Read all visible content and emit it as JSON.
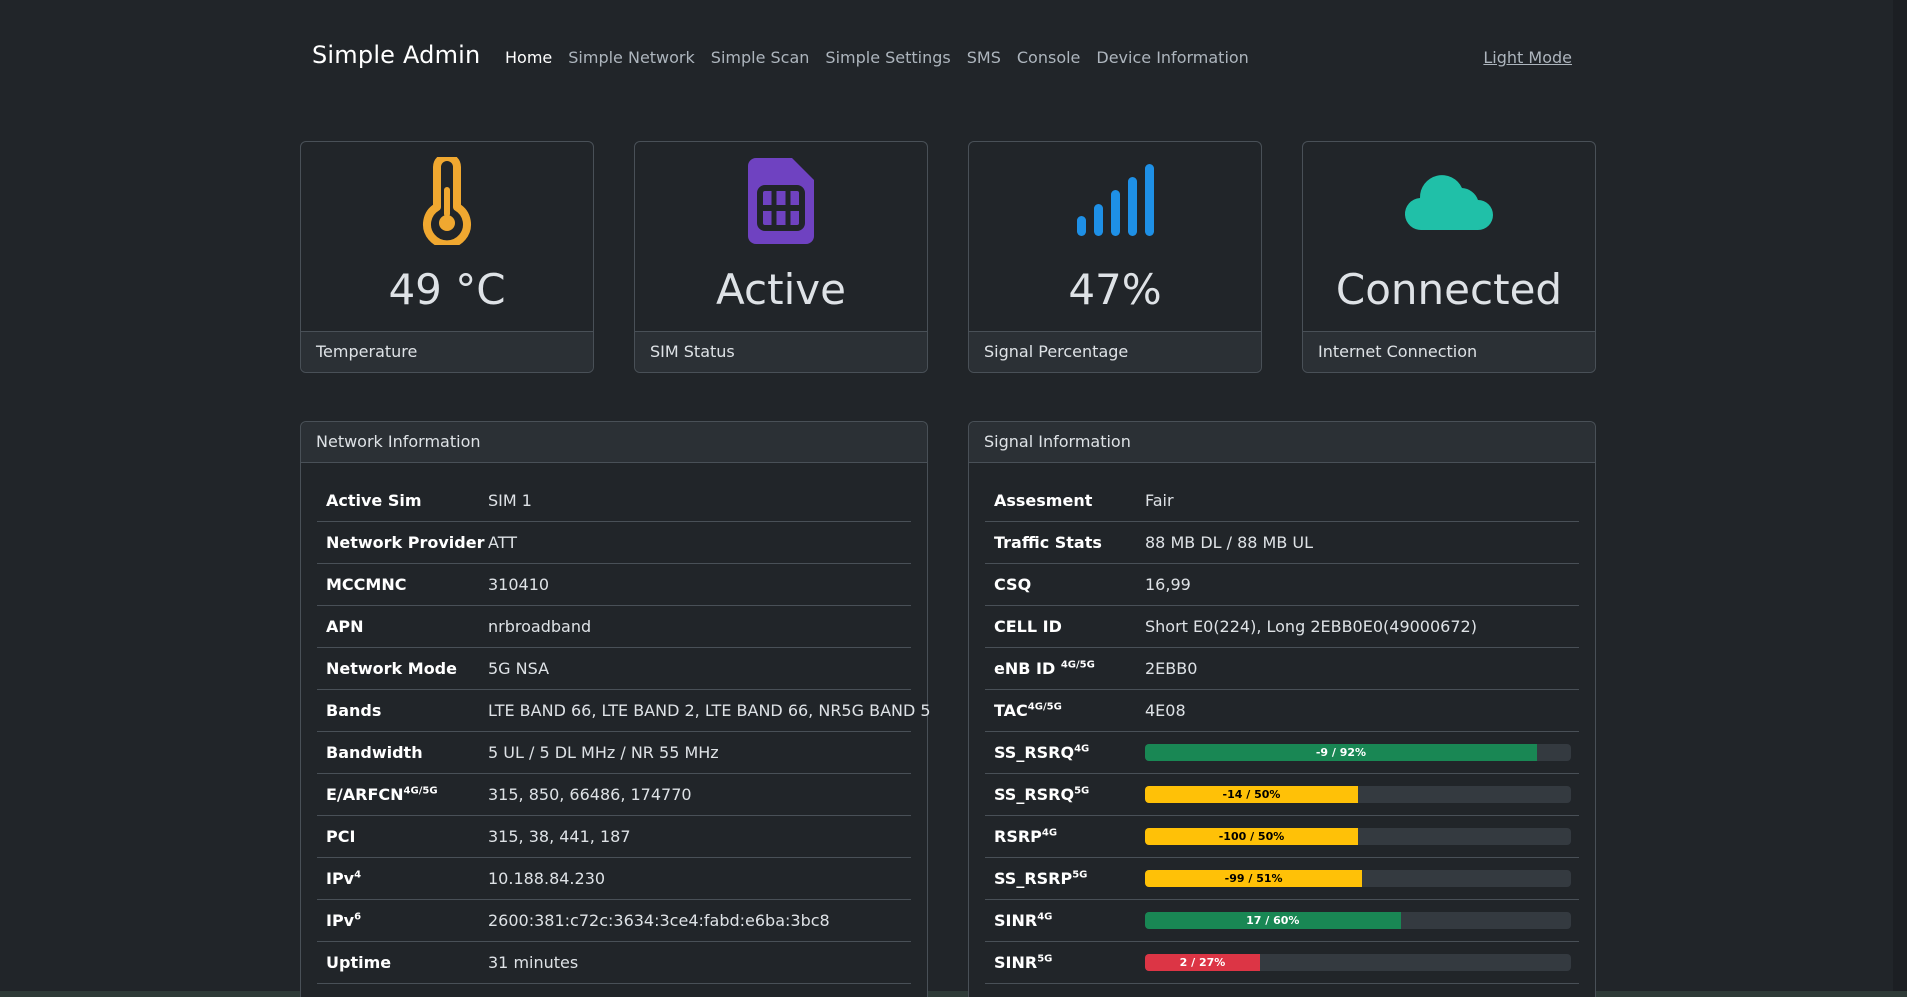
{
  "navbar": {
    "brand": "Simple Admin",
    "links": [
      "Home",
      "Simple Network",
      "Simple Scan",
      "Simple Settings",
      "SMS",
      "Console",
      "Device Information"
    ],
    "theme_toggle": "Light Mode"
  },
  "stats": [
    {
      "value": "49 °C",
      "label": "Temperature",
      "icon": "thermometer-icon",
      "color": "#f0a830"
    },
    {
      "value": "Active",
      "label": "SIM Status",
      "icon": "sim-card-icon",
      "color": "#6f42c1"
    },
    {
      "value": "47%",
      "label": "Signal Percentage",
      "icon": "signal-bars-icon",
      "color": "#1e90e6"
    },
    {
      "value": "Connected",
      "label": "Internet Connection",
      "icon": "cloud-icon",
      "color": "#20c0a8"
    }
  ],
  "network": {
    "title": "Network Information",
    "rows": [
      {
        "label": "Active Sim",
        "sup": "",
        "value": "SIM 1"
      },
      {
        "label": "Network Provider",
        "sup": "",
        "value": "ATT"
      },
      {
        "label": "MCCMNC",
        "sup": "",
        "value": "310410"
      },
      {
        "label": "APN",
        "sup": "",
        "value": "nrbroadband"
      },
      {
        "label": "Network Mode",
        "sup": "",
        "value": "5G NSA"
      },
      {
        "label": "Bands",
        "sup": "",
        "value": "LTE BAND 66, LTE BAND 2, LTE BAND 66, NR5G BAND 5"
      },
      {
        "label": "Bandwidth",
        "sup": "",
        "value": "5 UL / 5 DL MHz / NR 55 MHz"
      },
      {
        "label": "E/ARFCN",
        "sup": "4G/5G",
        "value": "315, 850, 66486, 174770"
      },
      {
        "label": "PCI",
        "sup": "",
        "value": "315, 38, 441, 187"
      },
      {
        "label": "IPv",
        "sup": "4",
        "value": "10.188.84.230"
      },
      {
        "label": "IPv",
        "sup": "6",
        "value": "2600:381:c72c:3634:3ce4:fabd:e6ba:3bc8"
      },
      {
        "label": "Uptime",
        "sup": "",
        "value": "31 minutes"
      }
    ]
  },
  "signal": {
    "title": "Signal Information",
    "rows": [
      {
        "label": "Assesment",
        "sup": "",
        "value": "Fair"
      },
      {
        "label": "Traffic Stats",
        "sup": "",
        "value": "88 MB DL / 88 MB UL"
      },
      {
        "label": "CSQ",
        "sup": "",
        "value": "16,99"
      },
      {
        "label": "CELL ID",
        "sup": "",
        "value": "Short E0(224), Long 2EBB0E0(49000672)"
      },
      {
        "label": "eNB ID ",
        "sup": "4G/5G",
        "value": "2EBB0"
      },
      {
        "label": "TAC",
        "sup": "4G/5G",
        "value": "4E08"
      }
    ],
    "bars": [
      {
        "label": "SS_RSRQ",
        "sup": "4G",
        "text": "-9 / 92%",
        "percent": 92,
        "level": "green"
      },
      {
        "label": "SS_RSRQ",
        "sup": "5G",
        "text": "-14 / 50%",
        "percent": 50,
        "level": "yellow"
      },
      {
        "label": "RSRP",
        "sup": "4G",
        "text": "-100 / 50%",
        "percent": 50,
        "level": "yellow"
      },
      {
        "label": "SS_RSRP",
        "sup": "5G",
        "text": "-99 / 51%",
        "percent": 51,
        "level": "yellow"
      },
      {
        "label": "SINR",
        "sup": "4G",
        "text": "17 / 60%",
        "percent": 60,
        "level": "green"
      },
      {
        "label": "SINR",
        "sup": "5G",
        "text": "2 / 27%",
        "percent": 27,
        "level": "red"
      }
    ]
  }
}
